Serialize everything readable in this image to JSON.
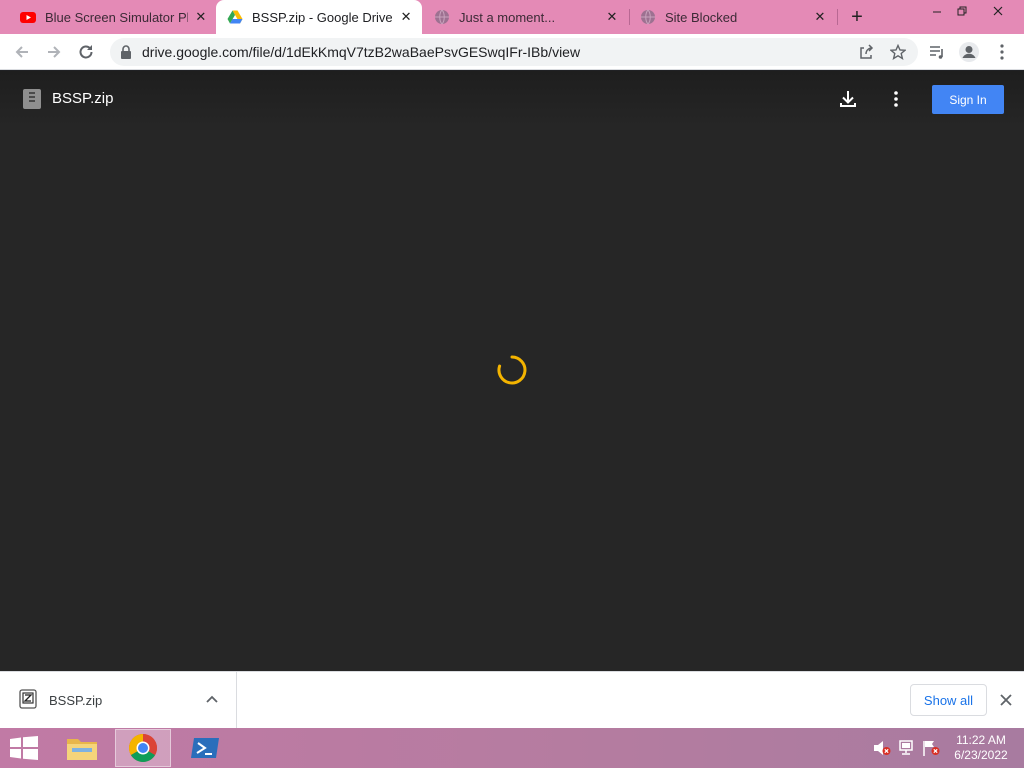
{
  "tabs": [
    {
      "title": "Blue Screen Simulator Plus",
      "icon": "youtube-icon",
      "active": false
    },
    {
      "title": "BSSP.zip - Google Drive",
      "icon": "google-drive-icon",
      "active": true
    },
    {
      "title": "Just a moment...",
      "icon": "globe-icon",
      "active": false
    },
    {
      "title": "Site Blocked",
      "icon": "globe-icon",
      "active": false
    }
  ],
  "address_bar": {
    "url": "drive.google.com/file/d/1dEkKmqV7tzB2waBaePsvGESwqIFr-IBb/view"
  },
  "viewer": {
    "file_name": "BSSP.zip",
    "signin_label": "Sign In",
    "loading": true,
    "spinner_color": "#f4b400"
  },
  "download_shelf": {
    "file_name": "BSSP.zip",
    "show_all_label": "Show all"
  },
  "taskbar": {
    "apps": [
      "file-explorer",
      "chrome",
      "powershell"
    ],
    "clock_time": "11:22 AM",
    "clock_date": "6/23/2022"
  },
  "colors": {
    "tabstrip": "#e48ab6",
    "viewer_bg": "#262626",
    "signin_button": "#4285f4",
    "showall_text": "#1a73e8"
  }
}
